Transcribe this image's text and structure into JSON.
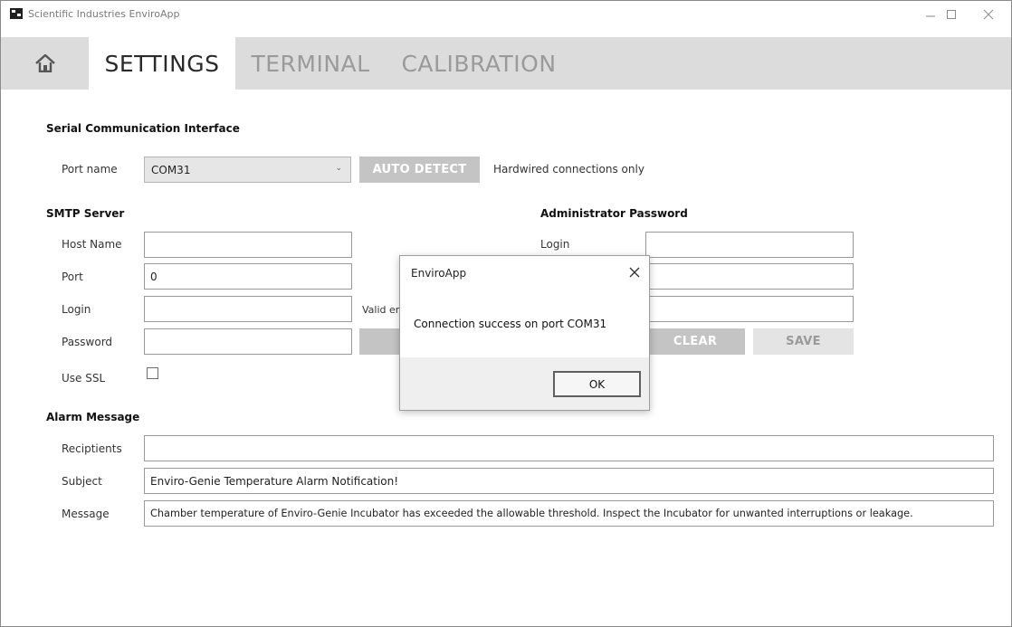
{
  "window": {
    "title": "Scientific Industries EnviroApp"
  },
  "tabs": [
    {
      "label": "SETTINGS"
    },
    {
      "label": "TERMINAL"
    },
    {
      "label": "CALIBRATION"
    }
  ],
  "serial": {
    "heading": "Serial Communication Interface",
    "port_label": "Port name",
    "port_value": "COM31",
    "auto_detect_label": "AUTO DETECT",
    "note": "Hardwired connections only"
  },
  "smtp": {
    "heading": "SMTP Server",
    "host_label": "Host Name",
    "host_value": "",
    "port_label": "Port",
    "port_value": "0",
    "login_label": "Login",
    "login_value": "",
    "login_note": "Valid er",
    "password_label": "Password",
    "password_value": "",
    "ssl_label": "Use SSL"
  },
  "admin": {
    "heading": "Administrator Password",
    "login_label": "Login",
    "clear_label": "CLEAR",
    "save_label": "SAVE"
  },
  "alarm": {
    "heading": "Alarm Message",
    "recipients_label": "Reciptients",
    "recipients_value": "",
    "subject_label": "Subject",
    "subject_value": "Enviro-Genie Temperature Alarm Notification!",
    "message_label": "Message",
    "message_value": "Chamber temperature of Enviro-Genie Incubator has exceeded the allowable threshold. Inspect the Incubator for unwanted interruptions or leakage."
  },
  "dialog": {
    "title": "EnviroApp",
    "message": "Connection success on port COM31",
    "ok_label": "OK"
  }
}
